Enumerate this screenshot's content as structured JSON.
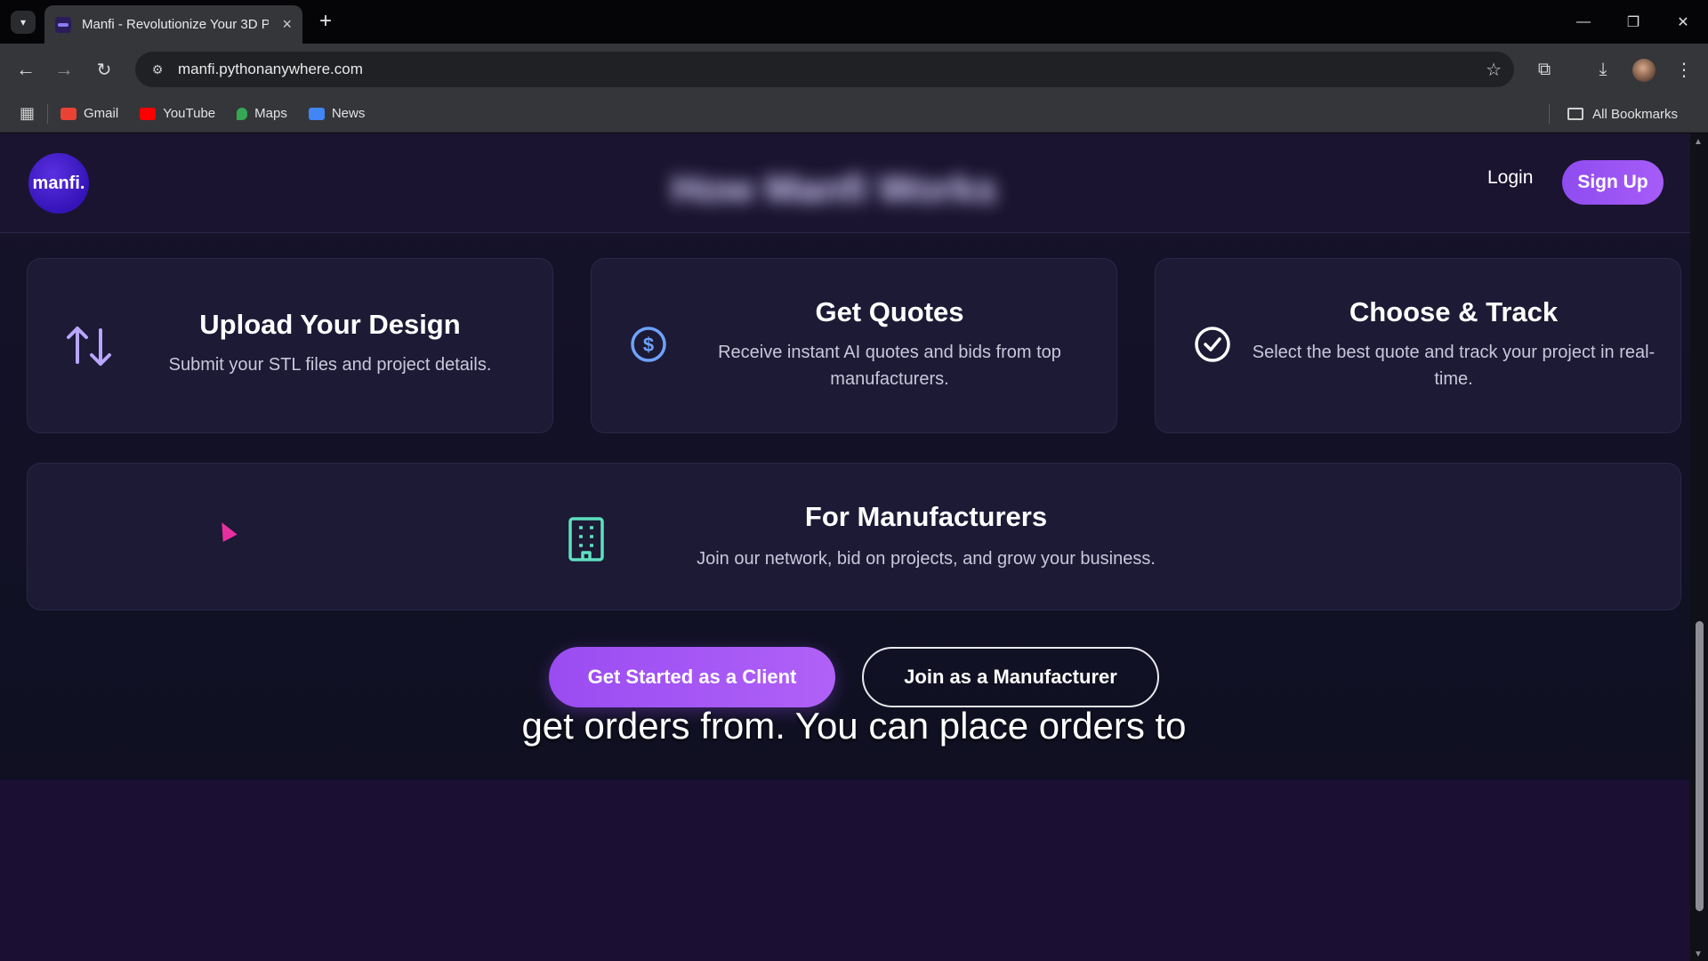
{
  "browser": {
    "tab_title": "Manfi - Revolutionize Your 3D P",
    "url": "manfi.pythonanywhere.com",
    "bookmarks": [
      {
        "label": "Gmail",
        "color": "#ea4335"
      },
      {
        "label": "YouTube",
        "color": "#ff0000"
      },
      {
        "label": "Maps",
        "color": "#34a853"
      },
      {
        "label": "News",
        "color": "#4285f4"
      }
    ],
    "all_bookmarks_label": "All Bookmarks"
  },
  "header": {
    "logo_text": "manfi.",
    "title_blurred": "How Manfi Works",
    "login_label": "Login",
    "signup_label": "Sign Up"
  },
  "steps": [
    {
      "icon": "arrows-up-down-icon",
      "title": "Upload Your Design",
      "desc": "Submit your STL files and project details."
    },
    {
      "icon": "dollar-circle-icon",
      "title": "Get Quotes",
      "desc": "Receive instant AI quotes and bids from top manufacturers."
    },
    {
      "icon": "check-circle-icon",
      "title": "Choose & Track",
      "desc": "Select the best quote and track your project in real-time."
    }
  ],
  "manufacturers": {
    "icon": "building-icon",
    "title": "For Manufacturers",
    "desc": "Join our network, bid on projects, and grow your business."
  },
  "cta": {
    "client_label": "Get Started as a Client",
    "manufacturer_label": "Join as a Manufacturer"
  },
  "subtitle": "get orders from. You can place orders to",
  "colors": {
    "accent": "#9a4cf2",
    "icon_purple": "#b9a6ff",
    "icon_blue": "#6ea2ff",
    "icon_teal": "#5ee0c1"
  }
}
